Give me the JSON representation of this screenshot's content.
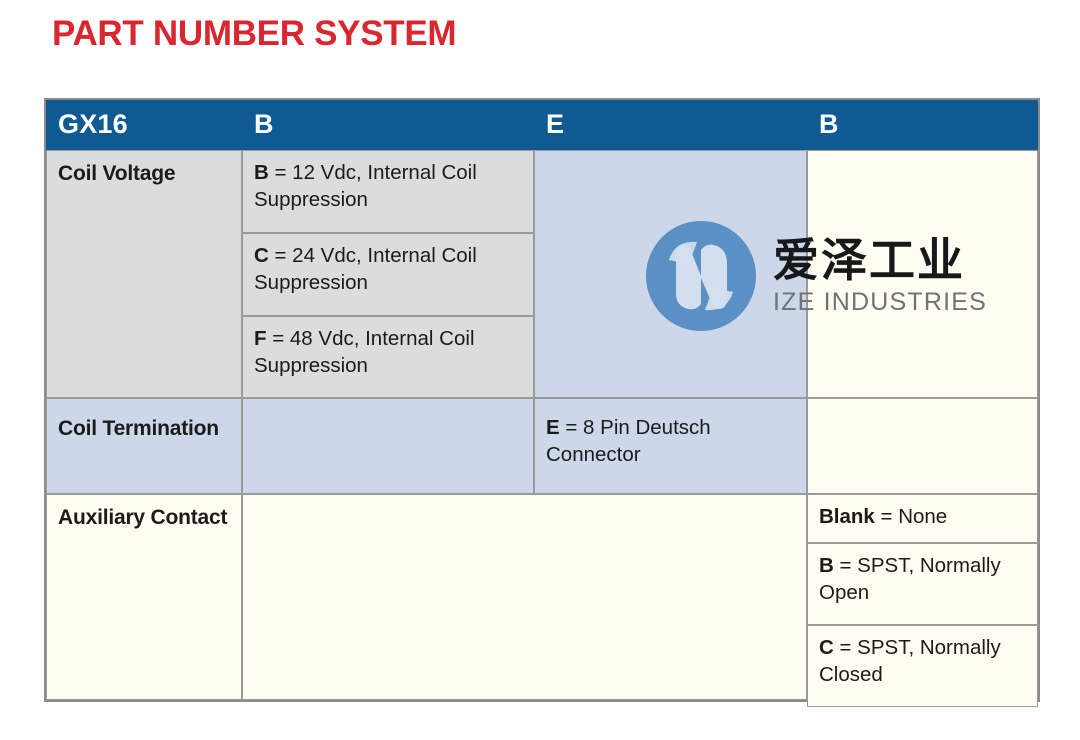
{
  "page": {
    "title": "PART NUMBER SYSTEM",
    "title_color": "#d9262f"
  },
  "colors": {
    "header_blue": "#0f5a93",
    "light_blue": "#ccd7e9",
    "gray": "#dcdcdc",
    "cream": "#fffdf2",
    "border": "#8c8c8c"
  },
  "table": {
    "header": [
      {
        "label": "GX16"
      },
      {
        "label": "B"
      },
      {
        "label": "E"
      },
      {
        "label": "B"
      }
    ],
    "rows": [
      {
        "label": "Coil Voltage",
        "options_col2": [
          {
            "code": "B",
            "desc": "= 12 Vdc, Internal Coil Suppression"
          },
          {
            "code": "C",
            "desc": "= 24 Vdc, Internal Coil Suppression"
          },
          {
            "code": "F",
            "desc": "= 48 Vdc, Internal Coil Suppression"
          }
        ],
        "options_col3": [],
        "options_col4": []
      },
      {
        "label": "Coil Termination",
        "options_col2": [],
        "options_col3": [
          {
            "code": "E",
            "desc": "= 8 Pin Deutsch Connector"
          }
        ],
        "options_col4": []
      },
      {
        "label": "Auxiliary Contact",
        "options_col2": [],
        "options_col3": [],
        "options_col4": [
          {
            "code": "Blank",
            "desc": "= None"
          },
          {
            "code": "B",
            "desc": "= SPST, Normally Open"
          },
          {
            "code": "C",
            "desc": "= SPST, Normally Closed"
          }
        ]
      }
    ]
  },
  "watermark": {
    "logo_icon": "ize-circle-logo-icon",
    "cn_name": "爱泽工业",
    "en_name": "IZE INDUSTRIES",
    "logo_color": "#5b90c4"
  }
}
